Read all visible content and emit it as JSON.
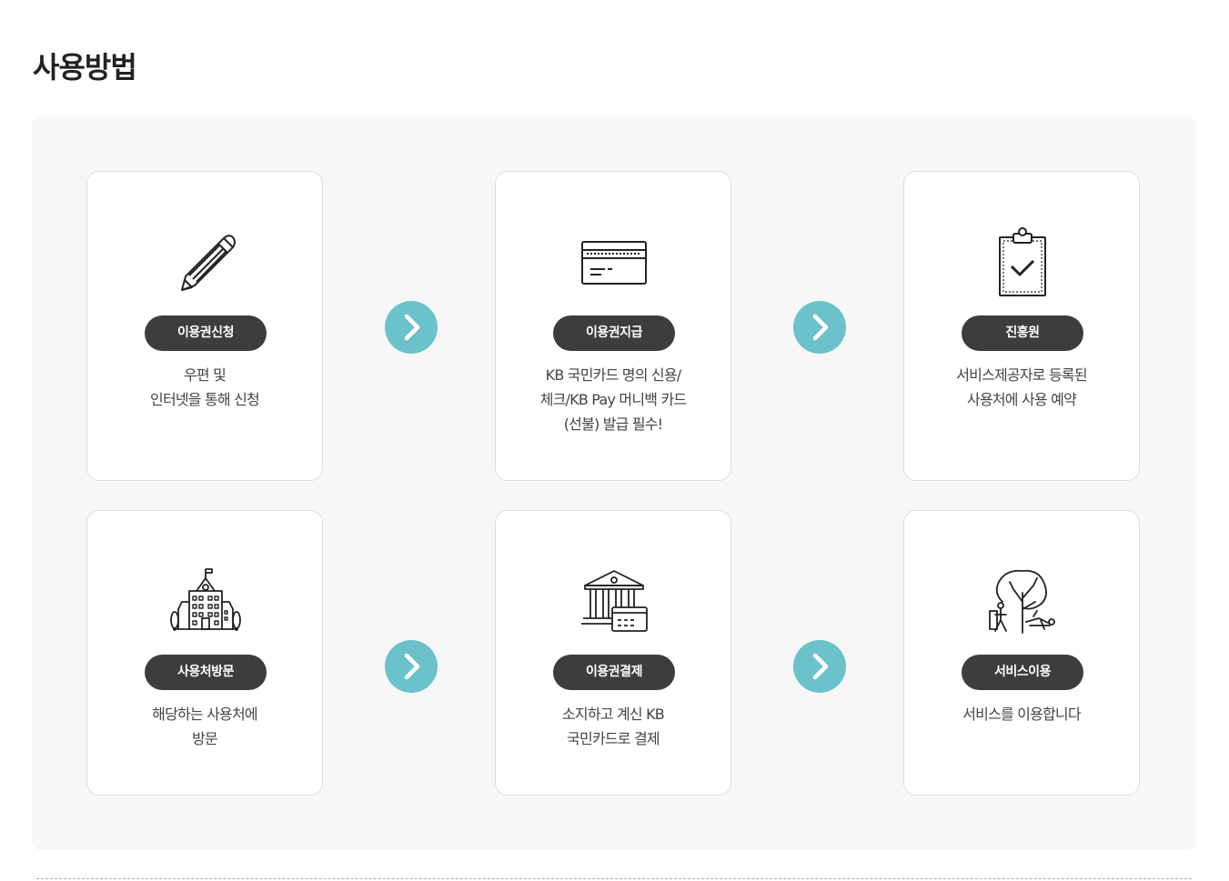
{
  "page": {
    "title": "사용방법"
  },
  "colors": {
    "badge_bg": "#3d3d3d",
    "arrow_bg": "#6cc2ca",
    "panel_bg": "#f7f7f7"
  },
  "steps": [
    {
      "icon": "pencil-icon",
      "badge": "이용권신청",
      "desc": [
        "우편 및",
        "인터넷을 통해 신청"
      ]
    },
    {
      "icon": "credit-card-icon",
      "badge": "이용권지급",
      "desc": [
        "KB 국민카드 명의 신용/",
        "체크/KB Pay 머니백 카드",
        "(선불) 발급 필수!"
      ]
    },
    {
      "icon": "clipboard-check-icon",
      "badge": "진흥원",
      "desc": [
        "서비스제공자로 등록된",
        "사용처에 사용 예약"
      ]
    },
    {
      "icon": "school-building-icon",
      "badge": "사용처방문",
      "desc": [
        "해당하는 사용처에",
        "방문"
      ]
    },
    {
      "icon": "bank-card-icon",
      "badge": "이용권결제",
      "desc": [
        "소지하고 계신 KB",
        "국민카드로 결제"
      ]
    },
    {
      "icon": "park-leisure-icon",
      "badge": "서비스이용",
      "desc": [
        "서비스를 이용합니다"
      ]
    }
  ],
  "arrows": [
    "chevron-right-icon",
    "chevron-right-icon",
    "chevron-right-icon",
    "chevron-right-icon"
  ]
}
